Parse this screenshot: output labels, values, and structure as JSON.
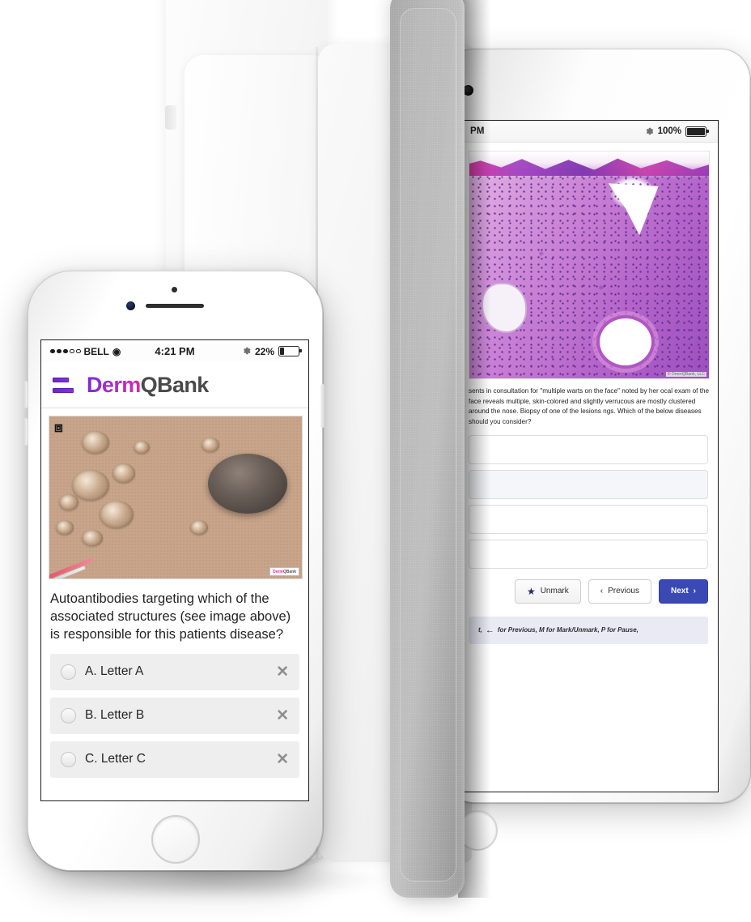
{
  "scene": {
    "description": "DermQBank app shown on a smartphone and a tablet",
    "brand_purple": "#7b2ad6",
    "brand_magenta": "#e0269e",
    "brand_grey": "#4a4a4a",
    "primary_button_color": "#3b49b5"
  },
  "phone": {
    "status_bar": {
      "signal_dots_filled": 3,
      "signal_dots_total": 5,
      "carrier": "BELL",
      "wifi_icon": "wifi-icon",
      "time": "4:21  PM",
      "bluetooth_icon": "bluetooth-icon",
      "battery_percent": "22%",
      "battery_icon": "battery-icon"
    },
    "header": {
      "menu_icon": "hamburger-menu-icon",
      "brand_part1": "Derm",
      "brand_part2": "QBank"
    },
    "image": {
      "expand_icon": "expand-fullscreen-icon",
      "watermark_part1": "Derm",
      "watermark_part2": "QBank",
      "alt": "clinical photograph of annular papules on chest skin"
    },
    "question": "Autoantibodies targeting which of the associated structures (see image above) is responsible for this patients disease?",
    "options": [
      {
        "letter": "A.",
        "label": "Letter A",
        "strike_icon": "cross-out-icon",
        "selected": false
      },
      {
        "letter": "B.",
        "label": "Letter B",
        "strike_icon": "cross-out-icon",
        "selected": false
      },
      {
        "letter": "C.",
        "label": "Letter C",
        "strike_icon": "cross-out-icon",
        "selected": false
      }
    ]
  },
  "tablet": {
    "status_bar": {
      "time_suffix": "PM",
      "bluetooth_icon": "bluetooth-icon",
      "battery_percent": "100%",
      "battery_icon": "battery-icon"
    },
    "image": {
      "watermark": "© DermQBank, LLC",
      "alt": "H&E histopathology slide of verrucous epidermal lesion"
    },
    "question": "sents in consultation for \"multiple warts on the face\" noted by her ocal exam of the face reveals multiple, skin-colored and slightly verrucous are mostly clustered around the nose. Biopsy of one of the lesions ngs. Which of the below diseases should you consider?",
    "question_lines": [
      "sents in consultation for \"multiple warts on the face\" noted by her",
      "ocal exam of the face reveals multiple, skin-colored and slightly verrucous",
      "are mostly clustered around the nose. Biopsy of one of the lesions",
      "ngs. Which of the below diseases should you consider?"
    ],
    "options": [
      {
        "label": "",
        "selected": false
      },
      {
        "label": "",
        "selected": true
      },
      {
        "label": "",
        "selected": false
      },
      {
        "label": "",
        "selected": false
      }
    ],
    "actions": {
      "mark_icon": "star-icon",
      "mark_label": "Unmark",
      "previous_icon": "chevron-left-icon",
      "previous_label": "Previous",
      "next_label": "Next",
      "next_icon": "chevron-right-icon"
    },
    "hint": {
      "prefix": "t,",
      "arrow_icon": "arrow-left-icon",
      "text": "for Previous, M for Mark/Unmark, P for Pause,"
    }
  }
}
